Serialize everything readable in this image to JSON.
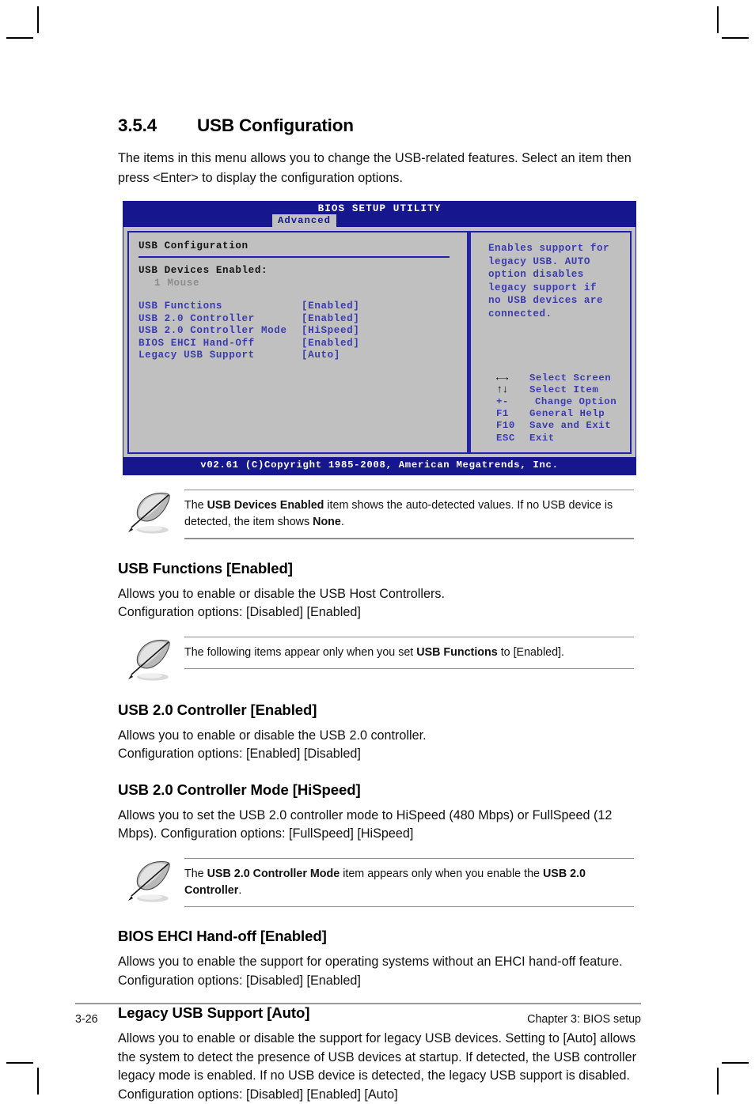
{
  "section": {
    "number": "3.5.4",
    "title": "USB Configuration",
    "intro": "The items in this menu allows you to change the USB-related features. Select an item then press <Enter> to display the configuration options."
  },
  "bios": {
    "title": "BIOS SETUP UTILITY",
    "active_tab": "Advanced",
    "panel_title": "USB Configuration",
    "devices_label": "USB Devices Enabled:",
    "devices_value": "1 Mouse",
    "items": [
      {
        "label": "USB Functions",
        "value": "[Enabled]"
      },
      {
        "label": "USB 2.0 Controller",
        "value": "[Enabled]"
      },
      {
        "label": "USB 2.0 Controller Mode",
        "value": "[HiSpeed]"
      },
      {
        "label": "BIOS EHCI Hand-Off",
        "value": "[Enabled]"
      },
      {
        "label": "Legacy USB Support",
        "value": "[Auto]"
      }
    ],
    "help_text": "Enables support for\nlegacy USB. AUTO\noption disables\nlegacy support if\nno USB devices are\nconnected.",
    "keys": [
      {
        "key": "←→",
        "action": "Select Screen",
        "glyph": true
      },
      {
        "key": "↑↓",
        "action": "Select Item",
        "glyph": true
      },
      {
        "key": "+-",
        "action": "Change Option",
        "glyph": false,
        "indent": true
      },
      {
        "key": "F1",
        "action": "General Help",
        "glyph": false
      },
      {
        "key": "F10",
        "action": "Save and Exit",
        "glyph": false
      },
      {
        "key": "ESC",
        "action": "Exit",
        "glyph": false
      }
    ],
    "footer": "v02.61 (C)Copyright 1985-2008, American Megatrends, Inc."
  },
  "notes": {
    "note1_pre": "The ",
    "note1_b1": "USB Devices Enabled",
    "note1_mid": " item shows the auto-detected values. If no USB device is detected, the item shows ",
    "note1_b2": "None",
    "note1_post": ".",
    "note2_pre": "The following items appear only when you set ",
    "note2_b1": "USB Functions",
    "note2_post": " to [Enabled].",
    "note3_pre": "The ",
    "note3_b1": "USB 2.0 Controller Mode",
    "note3_mid": " item appears only when you enable the ",
    "note3_b2": "USB 2.0 Controller",
    "note3_post": "."
  },
  "sections": {
    "usb_functions": {
      "heading": "USB Functions [Enabled]",
      "body": "Allows you to enable or disable the USB Host Controllers.\nConfiguration options: [Disabled] [Enabled]"
    },
    "usb20_controller": {
      "heading": "USB 2.0 Controller [Enabled]",
      "body": "Allows you to enable or disable the USB 2.0 controller.\nConfiguration options: [Enabled] [Disabled]"
    },
    "usb20_mode": {
      "heading": "USB 2.0 Controller Mode [HiSpeed]",
      "body": "Allows you to set the USB 2.0 controller mode to HiSpeed (480 Mbps) or FullSpeed (12 Mbps). Configuration options: [FullSpeed] [HiSpeed]"
    },
    "ehci_handoff": {
      "heading": "BIOS EHCI Hand-off [Enabled]",
      "body": "Allows you to enable the support for operating systems without an EHCI hand-off feature. Configuration options: [Disabled] [Enabled]"
    },
    "legacy_usb": {
      "heading": "Legacy USB Support [Auto]",
      "body": "Allows you to enable or disable the support for legacy USB devices. Setting to [Auto] allows the system to detect the presence of USB devices at startup. If detected, the USB controller legacy mode is enabled. If no USB device is detected, the legacy USB support is disabled. Configuration options: [Disabled] [Enabled] [Auto]"
    }
  },
  "page_footer": {
    "page_number": "3-26",
    "chapter": "Chapter 3: BIOS setup"
  },
  "colors": {
    "bios_navy": "#16168f",
    "bios_gray": "#c0c0c0",
    "bios_blue_text": "#3b3bb0",
    "rule_gray": "#8f8f8f"
  }
}
